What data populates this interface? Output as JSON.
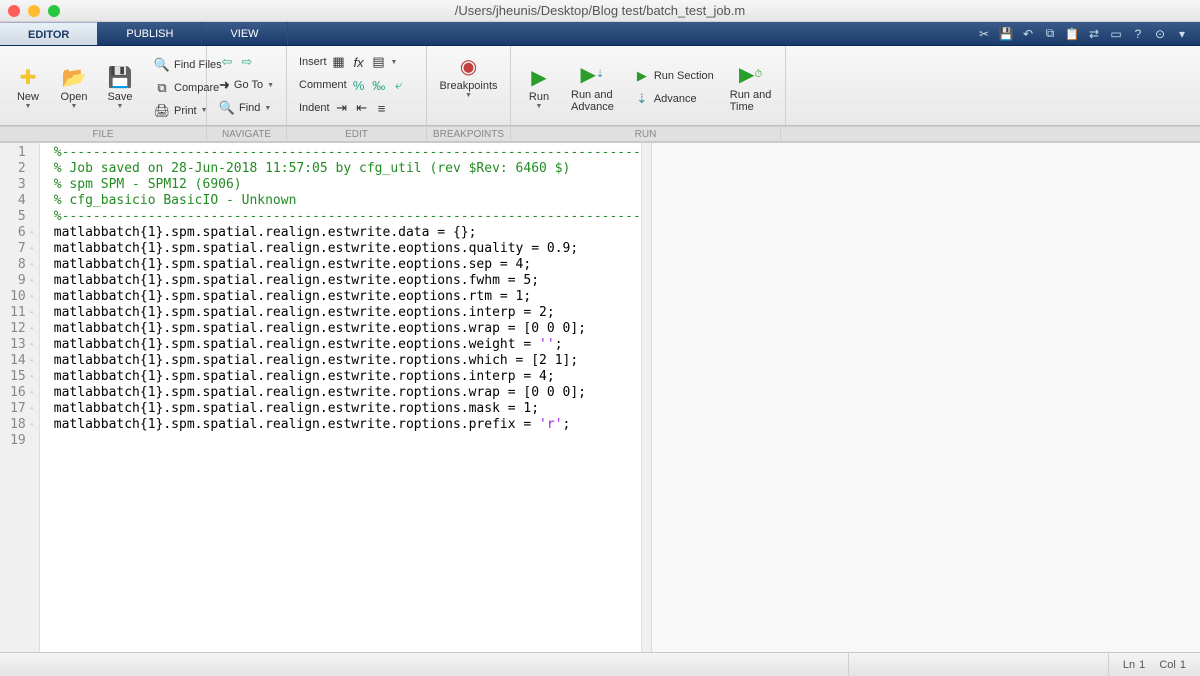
{
  "window": {
    "title": "/Users/jheunis/Desktop/Blog test/batch_test_job.m"
  },
  "tabs": {
    "editor": "EDITOR",
    "publish": "PUBLISH",
    "view": "VIEW"
  },
  "toolbar": {
    "new": "New",
    "open": "Open",
    "save": "Save",
    "findfiles": "Find Files",
    "compare": "Compare",
    "print": "Print",
    "goto": "Go To",
    "find": "Find",
    "insert": "Insert",
    "comment": "Comment",
    "indent": "Indent",
    "breakpoints": "Breakpoints",
    "run": "Run",
    "runadvance": "Run and\nAdvance",
    "runsection": "Run Section",
    "advance": "Advance",
    "runtime": "Run and\nTime"
  },
  "sections": {
    "file": "FILE",
    "navigate": "NAVIGATE",
    "edit": "EDIT",
    "breakpoints": "BREAKPOINTS",
    "run": "RUN"
  },
  "code": {
    "lines": [
      {
        "n": 1,
        "dash": false,
        "t": "%--------------------------------------------------------------------------",
        "cls": "c-comment"
      },
      {
        "n": 2,
        "dash": false,
        "t": "% Job saved on 28-Jun-2018 11:57:05 by cfg_util (rev $Rev: 6460 $)",
        "cls": "c-comment"
      },
      {
        "n": 3,
        "dash": false,
        "t": "% spm SPM - SPM12 (6906)",
        "cls": "c-comment"
      },
      {
        "n": 4,
        "dash": false,
        "t": "% cfg_basicio BasicIO - Unknown",
        "cls": "c-comment"
      },
      {
        "n": 5,
        "dash": false,
        "t": "%--------------------------------------------------------------------------",
        "cls": "c-comment"
      },
      {
        "n": 6,
        "dash": true,
        "t": "matlabbatch{1}.spm.spatial.realign.estwrite.data = {};",
        "cls": ""
      },
      {
        "n": 7,
        "dash": true,
        "t": "matlabbatch{1}.spm.spatial.realign.estwrite.eoptions.quality = 0.9;",
        "cls": ""
      },
      {
        "n": 8,
        "dash": true,
        "t": "matlabbatch{1}.spm.spatial.realign.estwrite.eoptions.sep = 4;",
        "cls": ""
      },
      {
        "n": 9,
        "dash": true,
        "t": "matlabbatch{1}.spm.spatial.realign.estwrite.eoptions.fwhm = 5;",
        "cls": ""
      },
      {
        "n": 10,
        "dash": true,
        "t": "matlabbatch{1}.spm.spatial.realign.estwrite.eoptions.rtm = 1;",
        "cls": ""
      },
      {
        "n": 11,
        "dash": true,
        "t": "matlabbatch{1}.spm.spatial.realign.estwrite.eoptions.interp = 2;",
        "cls": ""
      },
      {
        "n": 12,
        "dash": true,
        "t": "matlabbatch{1}.spm.spatial.realign.estwrite.eoptions.wrap = [0 0 0];",
        "cls": ""
      },
      {
        "n": 13,
        "dash": true,
        "t": "matlabbatch{1}.spm.spatial.realign.estwrite.eoptions.weight = ",
        "cls": "",
        "tail": "''",
        "tailcls": "c-str",
        "end": ";"
      },
      {
        "n": 14,
        "dash": true,
        "t": "matlabbatch{1}.spm.spatial.realign.estwrite.roptions.which = [2 1];",
        "cls": ""
      },
      {
        "n": 15,
        "dash": true,
        "t": "matlabbatch{1}.spm.spatial.realign.estwrite.roptions.interp = 4;",
        "cls": ""
      },
      {
        "n": 16,
        "dash": true,
        "t": "matlabbatch{1}.spm.spatial.realign.estwrite.roptions.wrap = [0 0 0];",
        "cls": ""
      },
      {
        "n": 17,
        "dash": true,
        "t": "matlabbatch{1}.spm.spatial.realign.estwrite.roptions.mask = 1;",
        "cls": ""
      },
      {
        "n": 18,
        "dash": true,
        "t": "matlabbatch{1}.spm.spatial.realign.estwrite.roptions.prefix = ",
        "cls": "",
        "tail": "'r'",
        "tailcls": "c-str",
        "end": ";"
      },
      {
        "n": 19,
        "dash": false,
        "t": "",
        "cls": ""
      }
    ]
  },
  "status": {
    "ln_label": "Ln",
    "ln": "1",
    "col_label": "Col",
    "col": "1"
  }
}
